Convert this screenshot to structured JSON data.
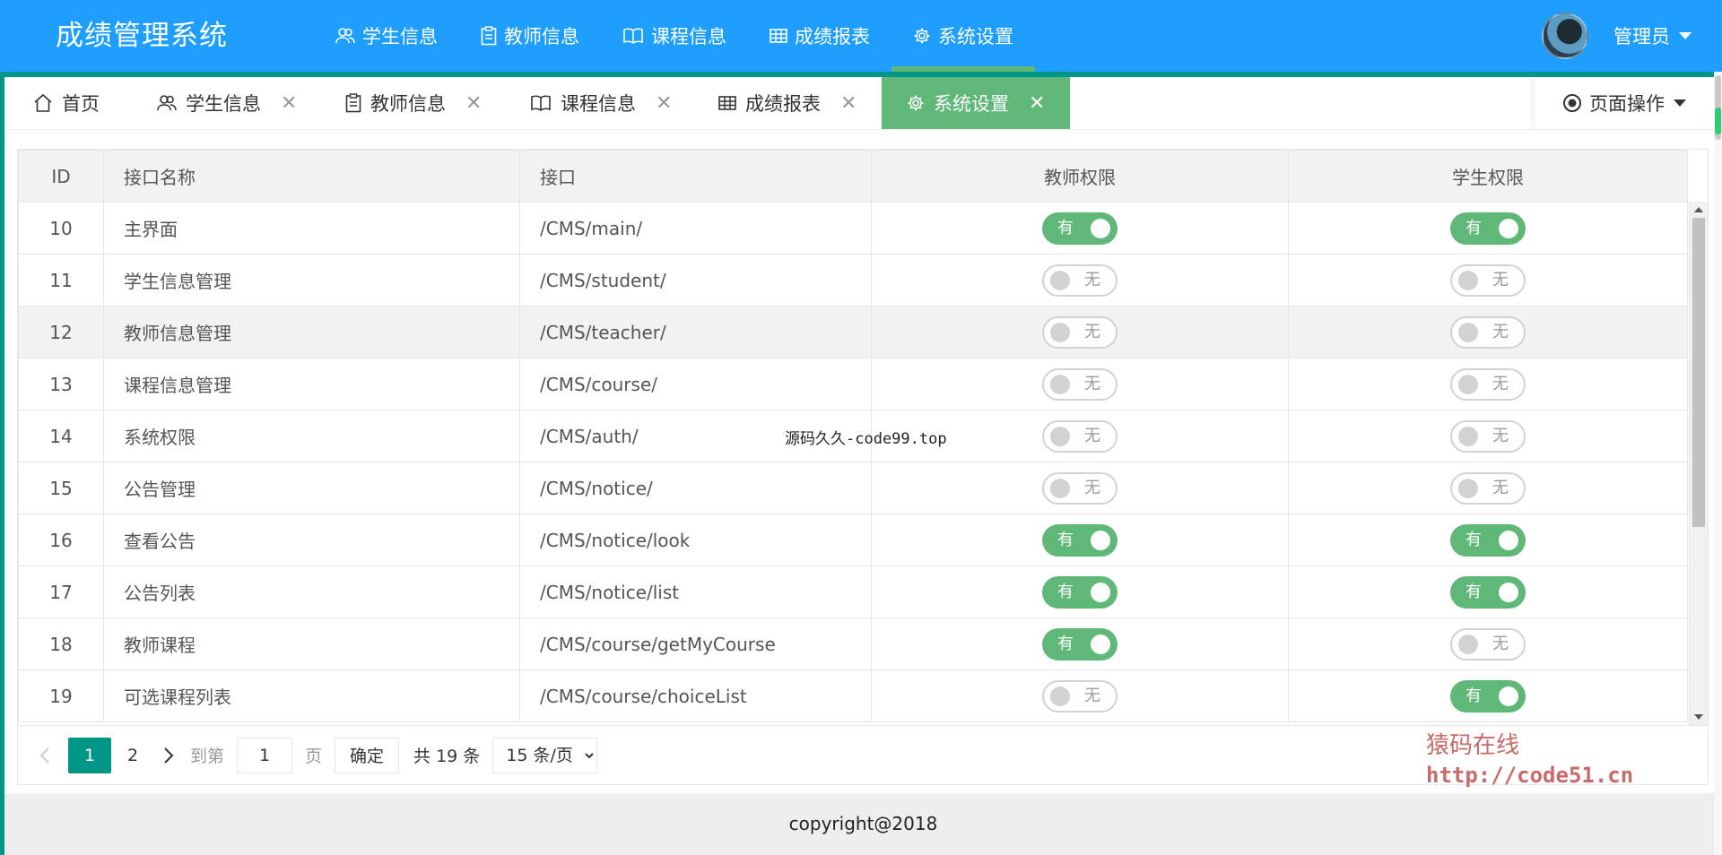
{
  "app": {
    "title": "成绩管理系统"
  },
  "nav": [
    {
      "label": "学生信息",
      "icon": "users-icon"
    },
    {
      "label": "教师信息",
      "icon": "clipboard-icon"
    },
    {
      "label": "课程信息",
      "icon": "book-icon"
    },
    {
      "label": "成绩报表",
      "icon": "table-icon"
    },
    {
      "label": "系统设置",
      "icon": "gear-icon"
    }
  ],
  "user": {
    "name": "管理员"
  },
  "tabs": {
    "home": "首页",
    "items": [
      "学生信息",
      "教师信息",
      "课程信息",
      "成绩报表",
      "系统设置"
    ],
    "active": "系统设置",
    "page_op": "页面操作"
  },
  "table": {
    "headers": {
      "id": "ID",
      "name": "接口名称",
      "api": "接口",
      "teacher": "教师权限",
      "student": "学生权限"
    },
    "on_text": "有",
    "off_text": "无",
    "rows": [
      {
        "id": "10",
        "name": "主界面",
        "api": "/CMS/main/",
        "teacher": true,
        "student": true
      },
      {
        "id": "11",
        "name": "学生信息管理",
        "api": "/CMS/student/",
        "teacher": false,
        "student": false
      },
      {
        "id": "12",
        "name": "教师信息管理",
        "api": "/CMS/teacher/",
        "teacher": false,
        "student": false
      },
      {
        "id": "13",
        "name": "课程信息管理",
        "api": "/CMS/course/",
        "teacher": false,
        "student": false
      },
      {
        "id": "14",
        "name": "系统权限",
        "api": "/CMS/auth/",
        "teacher": false,
        "student": false
      },
      {
        "id": "15",
        "name": "公告管理",
        "api": "/CMS/notice/",
        "teacher": false,
        "student": false
      },
      {
        "id": "16",
        "name": "查看公告",
        "api": "/CMS/notice/look",
        "teacher": true,
        "student": true
      },
      {
        "id": "17",
        "name": "公告列表",
        "api": "/CMS/notice/list",
        "teacher": true,
        "student": true
      },
      {
        "id": "18",
        "name": "教师课程",
        "api": "/CMS/course/getMyCourse",
        "teacher": true,
        "student": false
      },
      {
        "id": "19",
        "name": "可选课程列表",
        "api": "/CMS/course/choiceList",
        "teacher": false,
        "student": true
      }
    ]
  },
  "pagination": {
    "pages": [
      "1",
      "2"
    ],
    "current": "1",
    "goto_label": "到第",
    "goto_value": "1",
    "page_label": "页",
    "confirm": "确定",
    "total": "共 19 条",
    "limit": "15 条/页"
  },
  "watermarks": {
    "center": "源码久久-code99.top",
    "corner_line1": "猿码在线",
    "corner_line2": "http://code51.cn"
  },
  "footer": {
    "copyright": "copyright@2018"
  },
  "colors": {
    "header": "#1E9FFF",
    "accent": "#5FB878",
    "frame": "#009688"
  }
}
